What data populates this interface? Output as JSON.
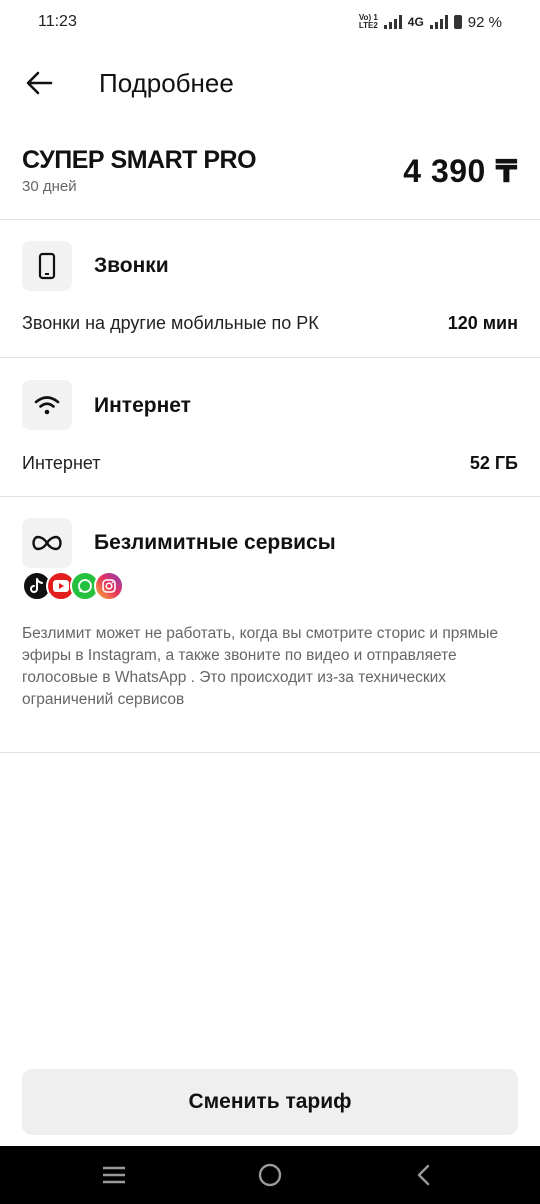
{
  "status_bar": {
    "time": "11:23",
    "volte_line1": "Vo) 1",
    "volte_line2": "LTE2",
    "network": "4G",
    "battery": "92 %"
  },
  "header": {
    "title": "Подробнее",
    "back_icon": "arrow-left-icon"
  },
  "plan": {
    "name": "СУПЕР SMART PRO",
    "period": "30 дней",
    "price": "4 390 ₸"
  },
  "sections": {
    "calls": {
      "icon": "phone-icon",
      "title": "Звонки",
      "row_label": "Звонки на другие мобильные по РК",
      "row_value": "120 мин"
    },
    "internet": {
      "icon": "wifi-icon",
      "title": "Интернет",
      "row_label": "Интернет",
      "row_value": "52 ГБ"
    },
    "unlimited": {
      "icon": "infinity-icon",
      "title": "Безлимитные сервисы",
      "apps": [
        "tiktok-icon",
        "youtube-icon",
        "whatsapp-icon",
        "instagram-icon"
      ],
      "disclaimer": "Безлимит может не работать, когда вы смотрите сторис и прямые эфиры в Instagram, а также звоните по видео и отправляете голосовые в WhatsApp . Это происходит из-за технических ограничений сервисов"
    }
  },
  "action_button": {
    "label": "Сменить тариф"
  },
  "colors": {
    "tiktok": "#111111",
    "youtube": "#e21d1d",
    "whatsapp": "#25c13e",
    "button_bg": "#efefef"
  },
  "navbar": {
    "items": [
      "recents-icon",
      "home-icon",
      "back-icon"
    ]
  }
}
